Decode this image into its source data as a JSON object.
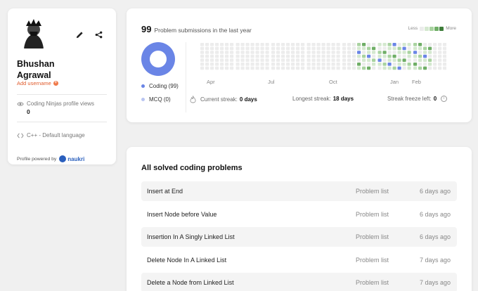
{
  "profile": {
    "first_name": "Bhushan",
    "last_name": "Agrawal",
    "add_username": "Add username",
    "views_label": "Coding Ninjas profile views",
    "views_count": "0",
    "language": "C++ - Default language",
    "powered_by": "Profile powered by",
    "naukri": "naukri",
    "icons": {
      "edit": "pencil-icon",
      "share": "share-icon",
      "views": "eye-icon",
      "language": "code-icon"
    }
  },
  "activity": {
    "count": "99",
    "label": "Problem submissions in the last year",
    "legend_less": "Less",
    "legend_more": "More",
    "legend_colors": [
      "#ececec",
      "#d4e8cf",
      "#a9d3a0",
      "#6fae66",
      "#3e7d3a"
    ],
    "coding_label": "Coding (99)",
    "mcq_label": "MCQ (0)",
    "coding_color": "#6a85e6",
    "mcq_color": "#b9c5f1",
    "months": [
      "Apr",
      "Jul",
      "Oct",
      "Jan",
      "Feb"
    ],
    "current_streak_label": "Current streak:",
    "current_streak_value": "0 days",
    "longest_streak_label": "Longest streak:",
    "longest_streak_value": "18 days",
    "freeze_label": "Streak freeze left:",
    "freeze_value": "0"
  },
  "problems": {
    "title": "All solved coding problems",
    "rows": [
      {
        "name": "Insert at End",
        "list": "Problem list",
        "time": "6 days ago"
      },
      {
        "name": "Insert Node before Value",
        "list": "Problem list",
        "time": "6 days ago"
      },
      {
        "name": "Insertion In A Singly Linked List",
        "list": "Problem list",
        "time": "6 days ago"
      },
      {
        "name": "Delete Node In A Linked List",
        "list": "Problem list",
        "time": "7 days ago"
      },
      {
        "name": "Delete a Node from Linked List",
        "list": "Problem list",
        "time": "7 days ago"
      }
    ]
  }
}
